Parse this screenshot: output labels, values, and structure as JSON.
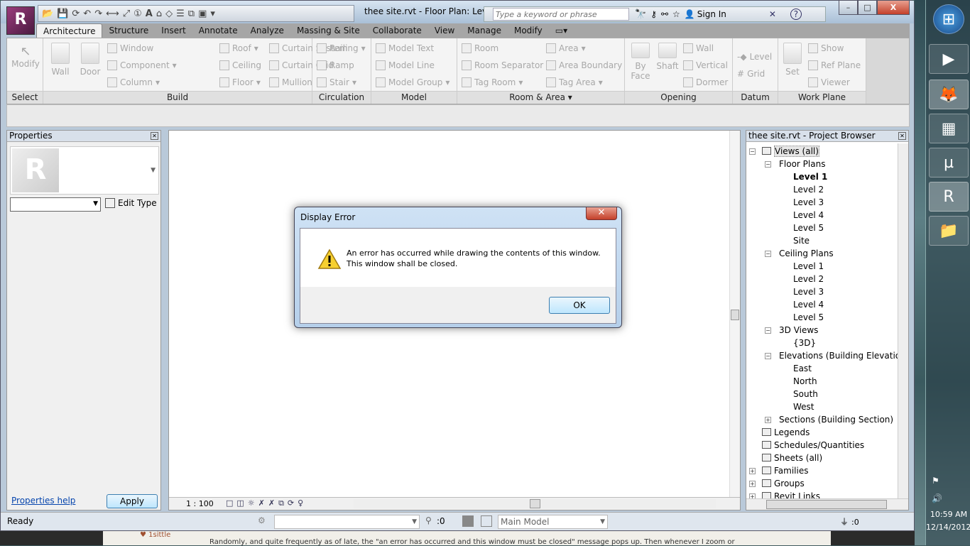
{
  "window": {
    "title": "thee site.rvt - Floor Plan: Leve...",
    "app_letter": "R",
    "search_placeholder": "Type a keyword or phrase",
    "sign_in": "Sign In",
    "minimize": "–",
    "maximize": "□",
    "close": "X",
    "help": "?"
  },
  "tabs": [
    "Architecture",
    "Structure",
    "Insert",
    "Annotate",
    "Analyze",
    "Massing & Site",
    "Collaborate",
    "View",
    "Manage",
    "Modify"
  ],
  "ribbon": {
    "select": {
      "label": "Select",
      "modify": "Modify"
    },
    "build": {
      "label": "Build",
      "wall": "Wall",
      "door": "Door",
      "window": "Window",
      "component": "Component",
      "column": "Column",
      "roof": "Roof",
      "ceiling": "Ceiling",
      "floor": "Floor",
      "curtain_system": "Curtain System",
      "curtain_grid": "Curtain Grid",
      "mullion": "Mullion"
    },
    "circulation": {
      "label": "Circulation",
      "railing": "Railing",
      "ramp": "Ramp",
      "stair": "Stair"
    },
    "model": {
      "label": "Model",
      "model_text": "Model Text",
      "model_line": "Model Line",
      "model_group": "Model Group"
    },
    "room_area": {
      "label": "Room & Area",
      "room": "Room",
      "room_separator": "Room Separator",
      "tag_room": "Tag Room",
      "area": "Area",
      "area_boundary": "Area Boundary",
      "tag_area": "Tag Area"
    },
    "opening": {
      "label": "Opening",
      "by_face": "By Face",
      "shaft": "Shaft",
      "wall": "Wall",
      "vertical": "Vertical",
      "dormer": "Dormer"
    },
    "datum": {
      "label": "Datum",
      "level": "Level",
      "grid": "Grid"
    },
    "work_plane": {
      "label": "Work Plane",
      "set": "Set",
      "show": "Show",
      "ref_plane": "Ref Plane",
      "viewer": "Viewer"
    }
  },
  "properties": {
    "title": "Properties",
    "edit_type": "Edit Type",
    "help": "Properties help",
    "apply": "Apply"
  },
  "view": {
    "scale": "1 : 100"
  },
  "browser": {
    "title": "thee site.rvt - Project Browser",
    "tree": [
      {
        "label": "Views (all)",
        "level": 0,
        "toggle": "-",
        "icon": true
      },
      {
        "label": "Floor Plans",
        "level": 1,
        "toggle": "-"
      },
      {
        "label": "Level 1",
        "level": 2,
        "bold": true
      },
      {
        "label": "Level 2",
        "level": 2
      },
      {
        "label": "Level 3",
        "level": 2
      },
      {
        "label": "Level 4",
        "level": 2
      },
      {
        "label": "Level 5",
        "level": 2
      },
      {
        "label": "Site",
        "level": 2
      },
      {
        "label": "Ceiling Plans",
        "level": 1,
        "toggle": "-"
      },
      {
        "label": "Level 1",
        "level": 2
      },
      {
        "label": "Level 2",
        "level": 2
      },
      {
        "label": "Level 3",
        "level": 2
      },
      {
        "label": "Level 4",
        "level": 2
      },
      {
        "label": "Level 5",
        "level": 2
      },
      {
        "label": "3D Views",
        "level": 1,
        "toggle": "-"
      },
      {
        "label": "{3D}",
        "level": 2
      },
      {
        "label": "Elevations (Building Elevation",
        "level": 1,
        "toggle": "-"
      },
      {
        "label": "East",
        "level": 2
      },
      {
        "label": "North",
        "level": 2
      },
      {
        "label": "South",
        "level": 2
      },
      {
        "label": "West",
        "level": 2
      },
      {
        "label": "Sections (Building Section)",
        "level": 1,
        "toggle": "+"
      },
      {
        "label": "Legends",
        "level": 0,
        "icon": true
      },
      {
        "label": "Schedules/Quantities",
        "level": 0,
        "icon": true
      },
      {
        "label": "Sheets (all)",
        "level": 0,
        "icon": true
      },
      {
        "label": "Families",
        "level": 0,
        "toggle": "+",
        "icon": true
      },
      {
        "label": "Groups",
        "level": 0,
        "toggle": "+",
        "icon": true
      },
      {
        "label": "Revit Links",
        "level": 0,
        "toggle": "+",
        "icon": true
      }
    ]
  },
  "status": {
    "text": "Ready",
    "worksets": ":0",
    "model": "Main Model",
    "filter": ":0"
  },
  "dialog": {
    "title": "Display Error",
    "line1": "An error has occurred while drawing the contents of this window.",
    "line2": "This window shall be closed.",
    "ok": "OK"
  },
  "taskbar": {
    "time": "10:59 AM",
    "date": "12/14/2012"
  },
  "background_page": {
    "user": "♥ 1sittle",
    "text": "Randomly, and quite frequently as of late, the \"an error has occurred and this window must be closed\" message pops up. Then whenever I zoom or"
  }
}
